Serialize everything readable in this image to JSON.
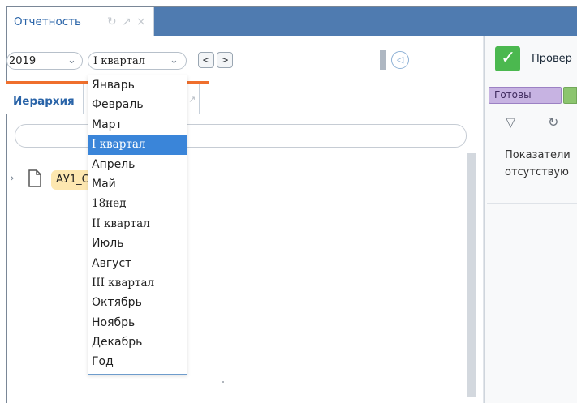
{
  "tab": {
    "title": "Отчетность",
    "icons": [
      "refresh-icon",
      "expand-icon",
      "close-icon"
    ]
  },
  "filters": {
    "year": "2019",
    "period": "I квартал",
    "prev_label": "<",
    "next_label": ">"
  },
  "hierarchy": {
    "tab_label": "Иерархия",
    "tree_node_label": "АУ1_С"
  },
  "period_options": [
    "Январь",
    "Февраль",
    "Март",
    "I квартал",
    "Апрель",
    "Май",
    "18нед",
    "II квартал",
    "Июль",
    "Август",
    "III квартал",
    "Октябрь",
    "Ноябрь",
    "Декабрь",
    "Год"
  ],
  "selected_period_index": 3,
  "right_panel": {
    "check_label": "Провер",
    "ready_badge": "Готовы",
    "message_line_1": "Показатели",
    "message_line_2": "отсутствую"
  },
  "colors": {
    "topbar": "#4f7bb0",
    "accent_orange": "#ef6f2d",
    "selected_bg": "#3a85d9",
    "check_green": "#4bb84f"
  }
}
